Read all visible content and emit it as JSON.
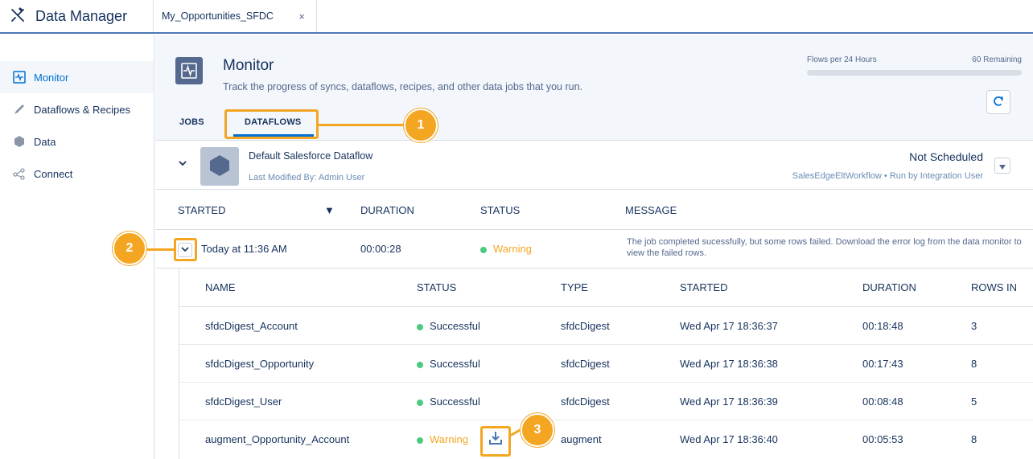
{
  "app": {
    "title": "Data Manager",
    "icon": "tools-icon"
  },
  "tabs": [
    {
      "label": "My_Opportunities_SFDC",
      "close": "×"
    }
  ],
  "sidebar": {
    "items": [
      {
        "label": "Monitor",
        "icon": "monitor-icon",
        "active": true
      },
      {
        "label": "Dataflows & Recipes",
        "icon": "pencil-icon"
      },
      {
        "label": "Data",
        "icon": "hexagon-icon"
      },
      {
        "label": "Connect",
        "icon": "share-icon"
      }
    ]
  },
  "header": {
    "title": "Monitor",
    "subtitle": "Track the progress of syncs, dataflows, recipes, and other data jobs that you run.",
    "flows_label": "Flows per 24 Hours",
    "flows_remaining": "60 Remaining",
    "flows_used_fraction": 0.0
  },
  "subtabs": {
    "jobs": "JOBS",
    "dataflows": "DATAFLOWS"
  },
  "callouts": [
    "1",
    "2",
    "3"
  ],
  "dataflow": {
    "name": "Default Salesforce Dataflow",
    "modified": "Last Modified By: Admin User",
    "schedule": "Not Scheduled",
    "run_info": "SalesEdgeEltWorkflow • Run by Integration User"
  },
  "job_table": {
    "headers": {
      "started": "STARTED",
      "duration": "DURATION",
      "status": "STATUS",
      "message": "MESSAGE"
    },
    "row": {
      "started": "Today at 11:36 AM",
      "duration": "00:00:28",
      "status": "Warning",
      "message": "The job completed sucessfully, but some rows failed. Download the error log from the data monitor to view the failed rows."
    }
  },
  "nested_table": {
    "headers": {
      "name": "NAME",
      "status": "STATUS",
      "type": "TYPE",
      "started": "STARTED",
      "duration": "DURATION",
      "rows": "ROWS IN"
    },
    "rows": [
      {
        "name": "sfdcDigest_Account",
        "status": "Successful",
        "type": "sfdcDigest",
        "started": "Wed Apr 17 18:36:37",
        "duration": "00:18:48",
        "rows": "3"
      },
      {
        "name": "sfdcDigest_Opportunity",
        "status": "Successful",
        "type": "sfdcDigest",
        "started": "Wed Apr 17 18:36:38",
        "duration": "00:17:43",
        "rows": "8"
      },
      {
        "name": "sfdcDigest_User",
        "status": "Successful",
        "type": "sfdcDigest",
        "started": "Wed Apr 17 18:36:39",
        "duration": "00:08:48",
        "rows": "5"
      },
      {
        "name": "augment_Opportunity_Account",
        "status": "Warning",
        "type": "augment",
        "started": "Wed Apr 17 18:36:40",
        "duration": "00:05:53",
        "rows": "8"
      }
    ]
  },
  "colors": {
    "accent": "#0070d2",
    "callout": "#f4a623",
    "success": "#4bca81",
    "warning": "#f4a623"
  }
}
